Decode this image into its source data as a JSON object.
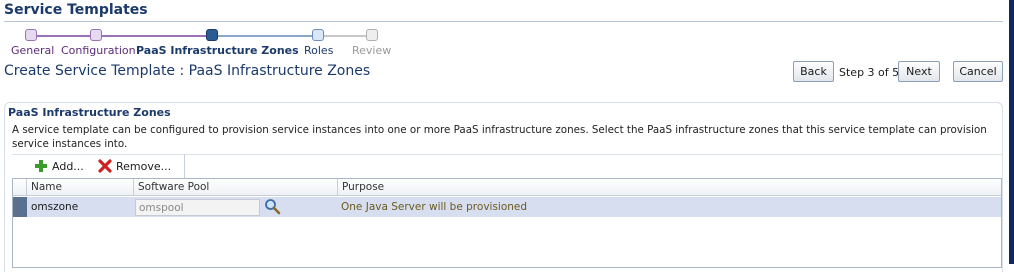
{
  "page": {
    "header": "Service Templates"
  },
  "train": {
    "steps": [
      {
        "label": "General",
        "state": "done"
      },
      {
        "label": "Configuration",
        "state": "done"
      },
      {
        "label": "PaaS Infrastructure Zones",
        "state": "current"
      },
      {
        "label": "Roles",
        "state": "next"
      },
      {
        "label": "Review",
        "state": "future"
      }
    ]
  },
  "title_bar": {
    "title": "Create Service Template : PaaS Infrastructure Zones",
    "back_label": "Back",
    "step_indicator": "Step 3 of 5",
    "next_label": "Next",
    "cancel_label": "Cancel"
  },
  "section": {
    "header": "PaaS Infrastructure Zones",
    "description": "A service template can be configured to provision service instances into one or more PaaS infrastructure zones. Select the PaaS infrastructure zones that this service template can provision service instances into."
  },
  "toolbar": {
    "add_label": "Add...",
    "remove_label": "Remove..."
  },
  "table": {
    "columns": [
      "Name",
      "Software Pool",
      "Purpose"
    ],
    "rows": [
      {
        "name": "omszone",
        "software_pool": "omspool",
        "purpose": "One Java Server will be provisioned"
      }
    ]
  },
  "icons": {
    "add": "plus-icon",
    "remove": "red-x-icon",
    "search": "magnifier-icon"
  },
  "colors": {
    "brand": "#1b3a6b",
    "accent_purple": "#9a72b5",
    "selected_row": "#d6deef",
    "purpose_text": "#6b5a1e"
  }
}
